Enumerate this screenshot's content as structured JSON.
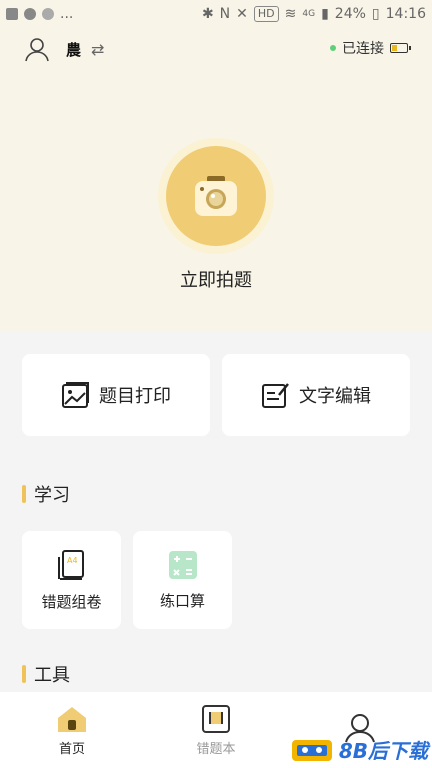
{
  "status_bar": {
    "left_icons": [
      "image-icon",
      "message-icon",
      "sync-icon",
      "more-icon"
    ],
    "more": "...",
    "hd": "HD",
    "signal": "4G",
    "battery": "24%",
    "time": "14:16"
  },
  "header": {
    "username": "農",
    "connection_status": "已连接",
    "connection_color": "#5fcf7a",
    "battery_color": "#e8b722"
  },
  "hero": {
    "button_label": "立即拍题",
    "accent": "#f0cd74"
  },
  "actions": [
    {
      "label": "题目打印",
      "icon": "image-print-icon"
    },
    {
      "label": "文字编辑",
      "icon": "text-edit-icon"
    }
  ],
  "sections": {
    "study": {
      "title": "学习",
      "items": [
        {
          "label": "错题组卷",
          "icon": "a4-paper-icon"
        },
        {
          "label": "练口算",
          "icon": "calculator-icon"
        }
      ]
    },
    "tools": {
      "title": "工具"
    }
  },
  "tabs": [
    {
      "label": "首页",
      "icon": "home-icon",
      "active": true
    },
    {
      "label": "错题本",
      "icon": "notebook-icon",
      "active": false
    },
    {
      "label": "",
      "icon": "profile-icon",
      "active": false
    }
  ],
  "watermark": "8B后下载"
}
